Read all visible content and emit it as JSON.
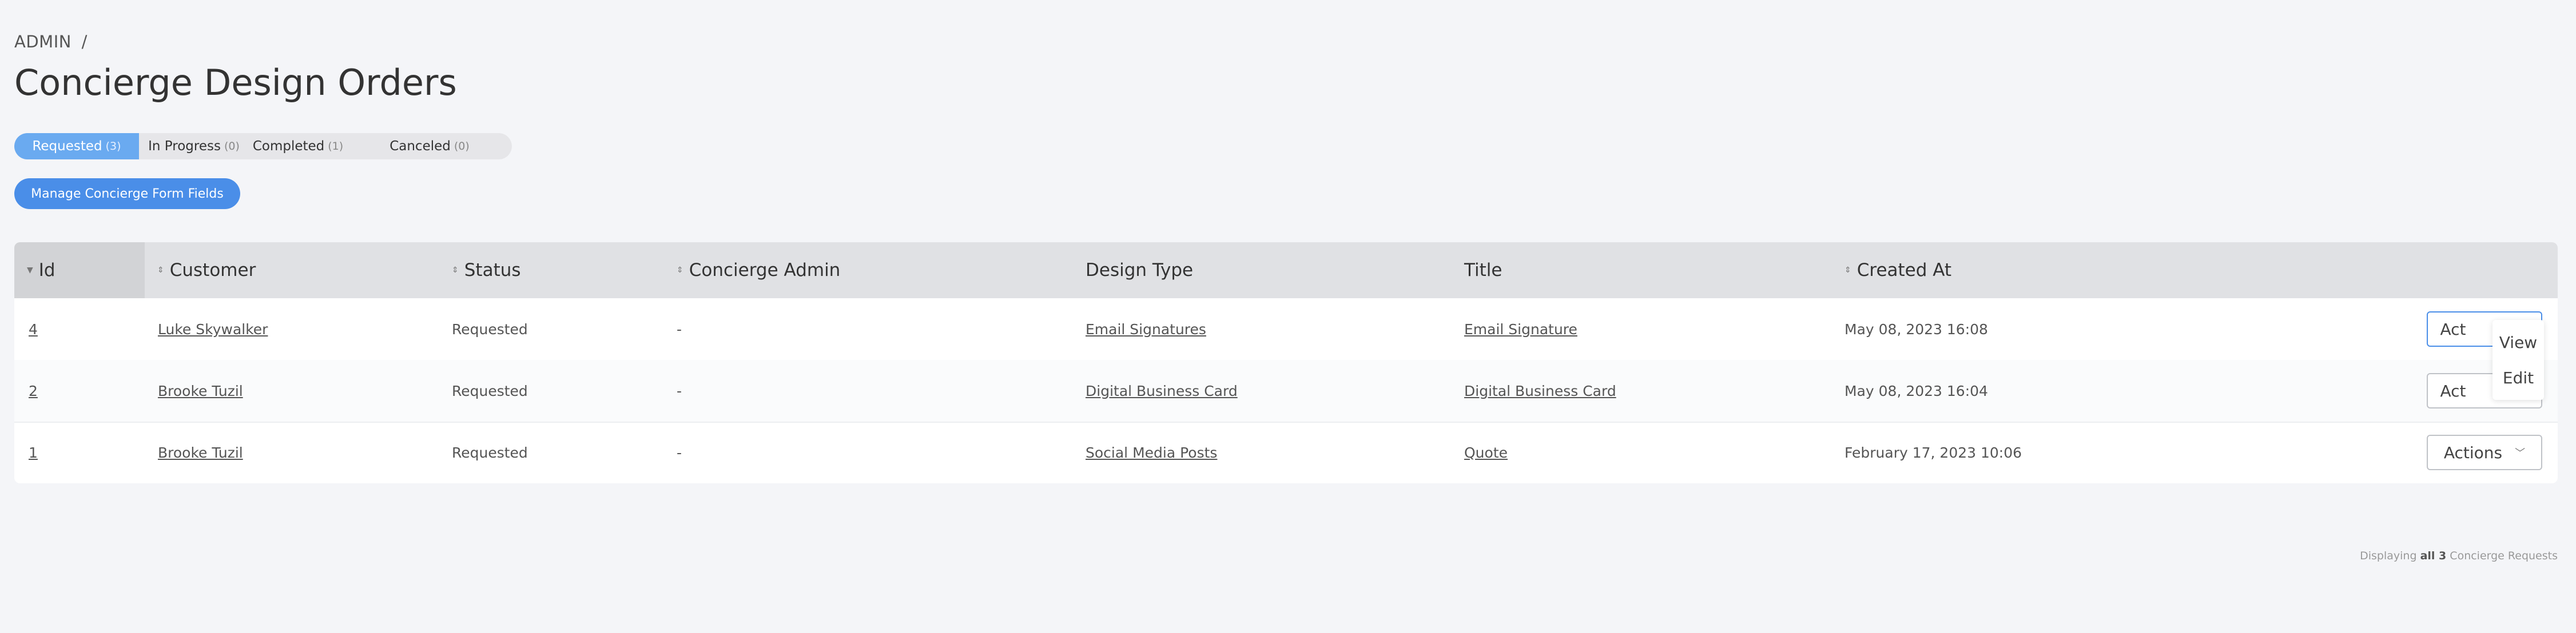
{
  "breadcrumb": {
    "label": "ADMIN",
    "separator": "/"
  },
  "page_title": "Concierge Design Orders",
  "scopes": [
    {
      "label": "Requested",
      "count": "(3)"
    },
    {
      "label": "In Progress",
      "count": "(0)"
    },
    {
      "label": "Completed",
      "count": "(1)"
    },
    {
      "label": "Canceled",
      "count": "(0)"
    }
  ],
  "manage_button": "Manage Concierge Form Fields",
  "table": {
    "columns": [
      "Id",
      "Customer",
      "Status",
      "Concierge Admin",
      "Design Type",
      "Title",
      "Created At"
    ],
    "rows": [
      {
        "id": "4",
        "customer": "Luke Skywalker",
        "status": "Requested",
        "admin": "-",
        "design_type": "Email Signatures",
        "title": "Email Signature",
        "created_at": "May 08, 2023 16:08"
      },
      {
        "id": "2",
        "customer": "Brooke Tuzil",
        "status": "Requested",
        "admin": "-",
        "design_type": "Digital Business Card",
        "title": "Digital Business Card",
        "created_at": "May 08, 2023 16:04"
      },
      {
        "id": "1",
        "customer": "Brooke Tuzil",
        "status": "Requested",
        "admin": "-",
        "design_type": "Social Media Posts",
        "title": "Quote",
        "created_at": "February 17, 2023 10:06"
      }
    ],
    "actions_label": "Actions",
    "actions_partial": "Act"
  },
  "dropdown": {
    "view": "View",
    "edit": "Edit"
  },
  "footer": {
    "prefix": "Displaying",
    "all": "all 3",
    "suffix": "Concierge Requests"
  },
  "colors": {
    "accent": "#4a8ee8",
    "active_scope": "#6aaaf0",
    "header_bg": "#e0e1e4",
    "page_bg": "#f4f5f8"
  }
}
